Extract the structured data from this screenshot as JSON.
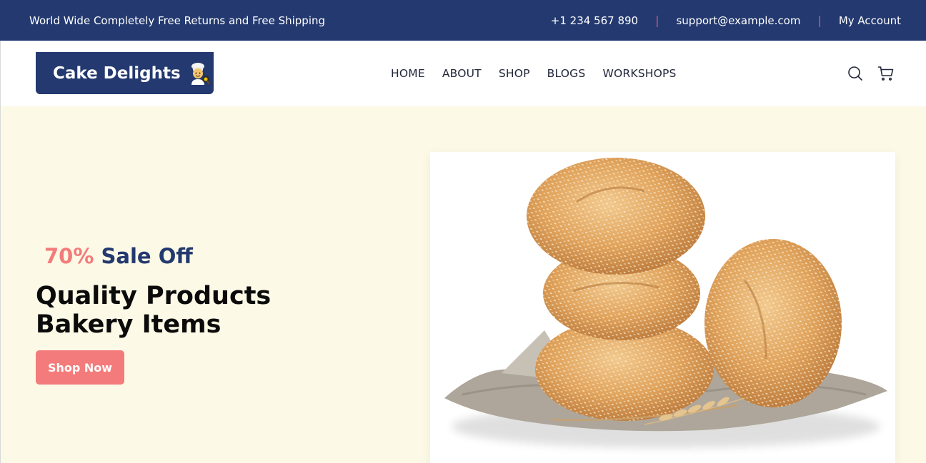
{
  "topbar": {
    "promo": "World Wide Completely Free Returns and Free Shipping",
    "phone": "+1 234 567 890",
    "separator": "|",
    "email": "support@example.com",
    "account": "My Account",
    "accent": "#23396f",
    "separator_color": "#e0578f"
  },
  "header": {
    "logo_text": "Cake Delights",
    "logo_icon": "cook-emoji-icon",
    "nav": [
      "HOME",
      "ABOUT",
      "SHOP",
      "BLOGS",
      "WORKSHOPS"
    ],
    "icons": [
      "search-icon",
      "cart-icon"
    ]
  },
  "hero": {
    "sale_percent": "70%",
    "sale_text": "Sale Off",
    "headline_line1": "Quality Products",
    "headline_line2": "Bakery Items",
    "cta": "Shop Now",
    "image": "sesame-bread-rolls-image",
    "background": "#fcf9e6",
    "cta_color": "#f47b7b"
  }
}
